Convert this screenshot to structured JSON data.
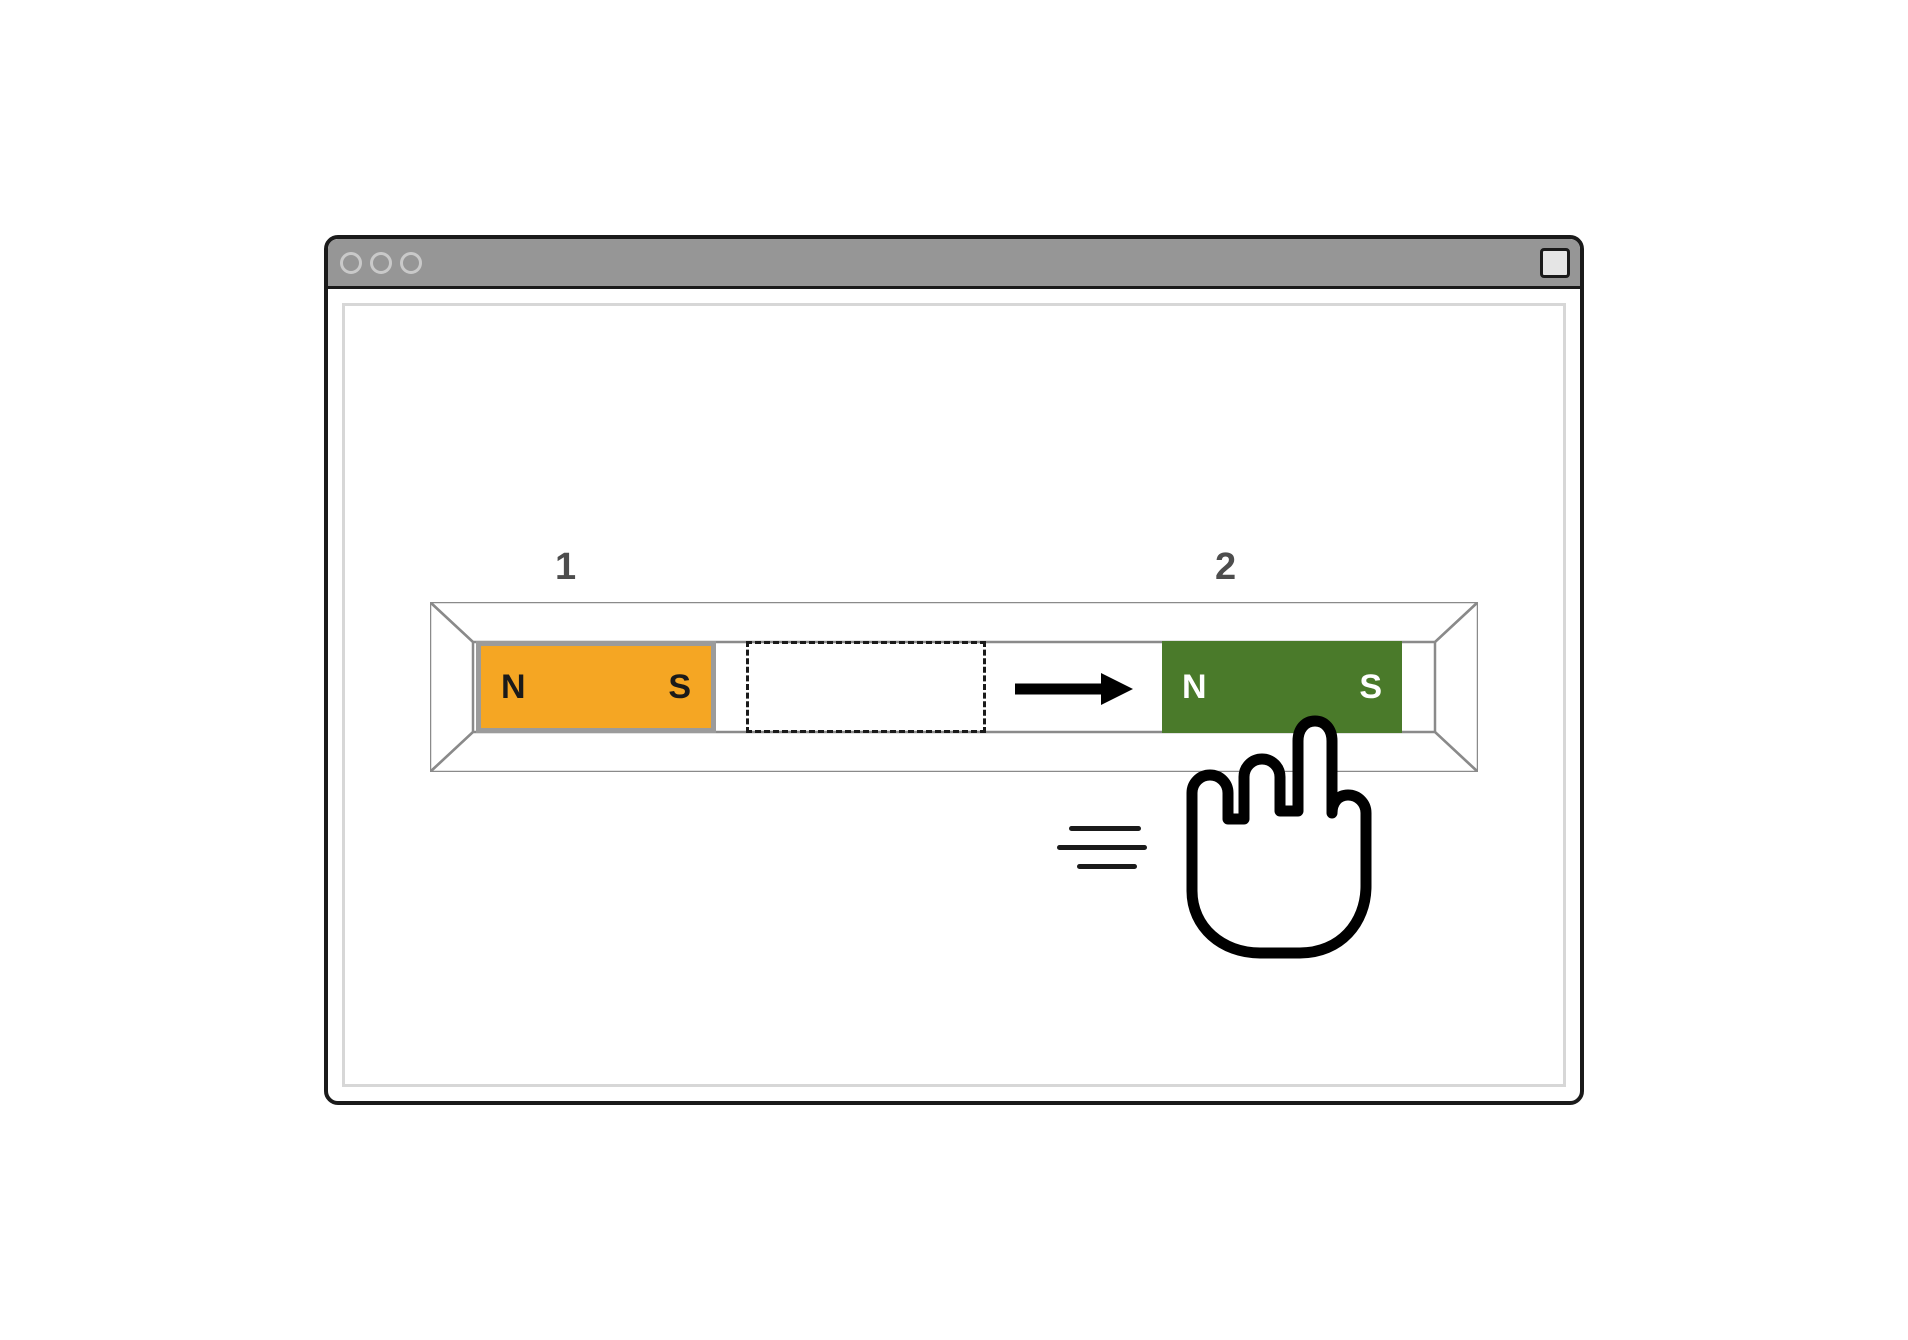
{
  "labels": {
    "magnet1_number": "1",
    "magnet2_number": "2"
  },
  "magnet1": {
    "left_pole": "N",
    "right_pole": "S",
    "color": "#f5a623",
    "text_color": "#1a1a1a"
  },
  "magnet2": {
    "left_pole": "N",
    "right_pole": "S",
    "color": "#4a7a2a",
    "text_color": "#ffffff"
  },
  "arrow_direction": "right",
  "colors": {
    "window_border": "#1a1a1a",
    "title_bar": "#969696",
    "inner_frame": "#d7d7d7",
    "track_line": "#8a8a8a"
  }
}
